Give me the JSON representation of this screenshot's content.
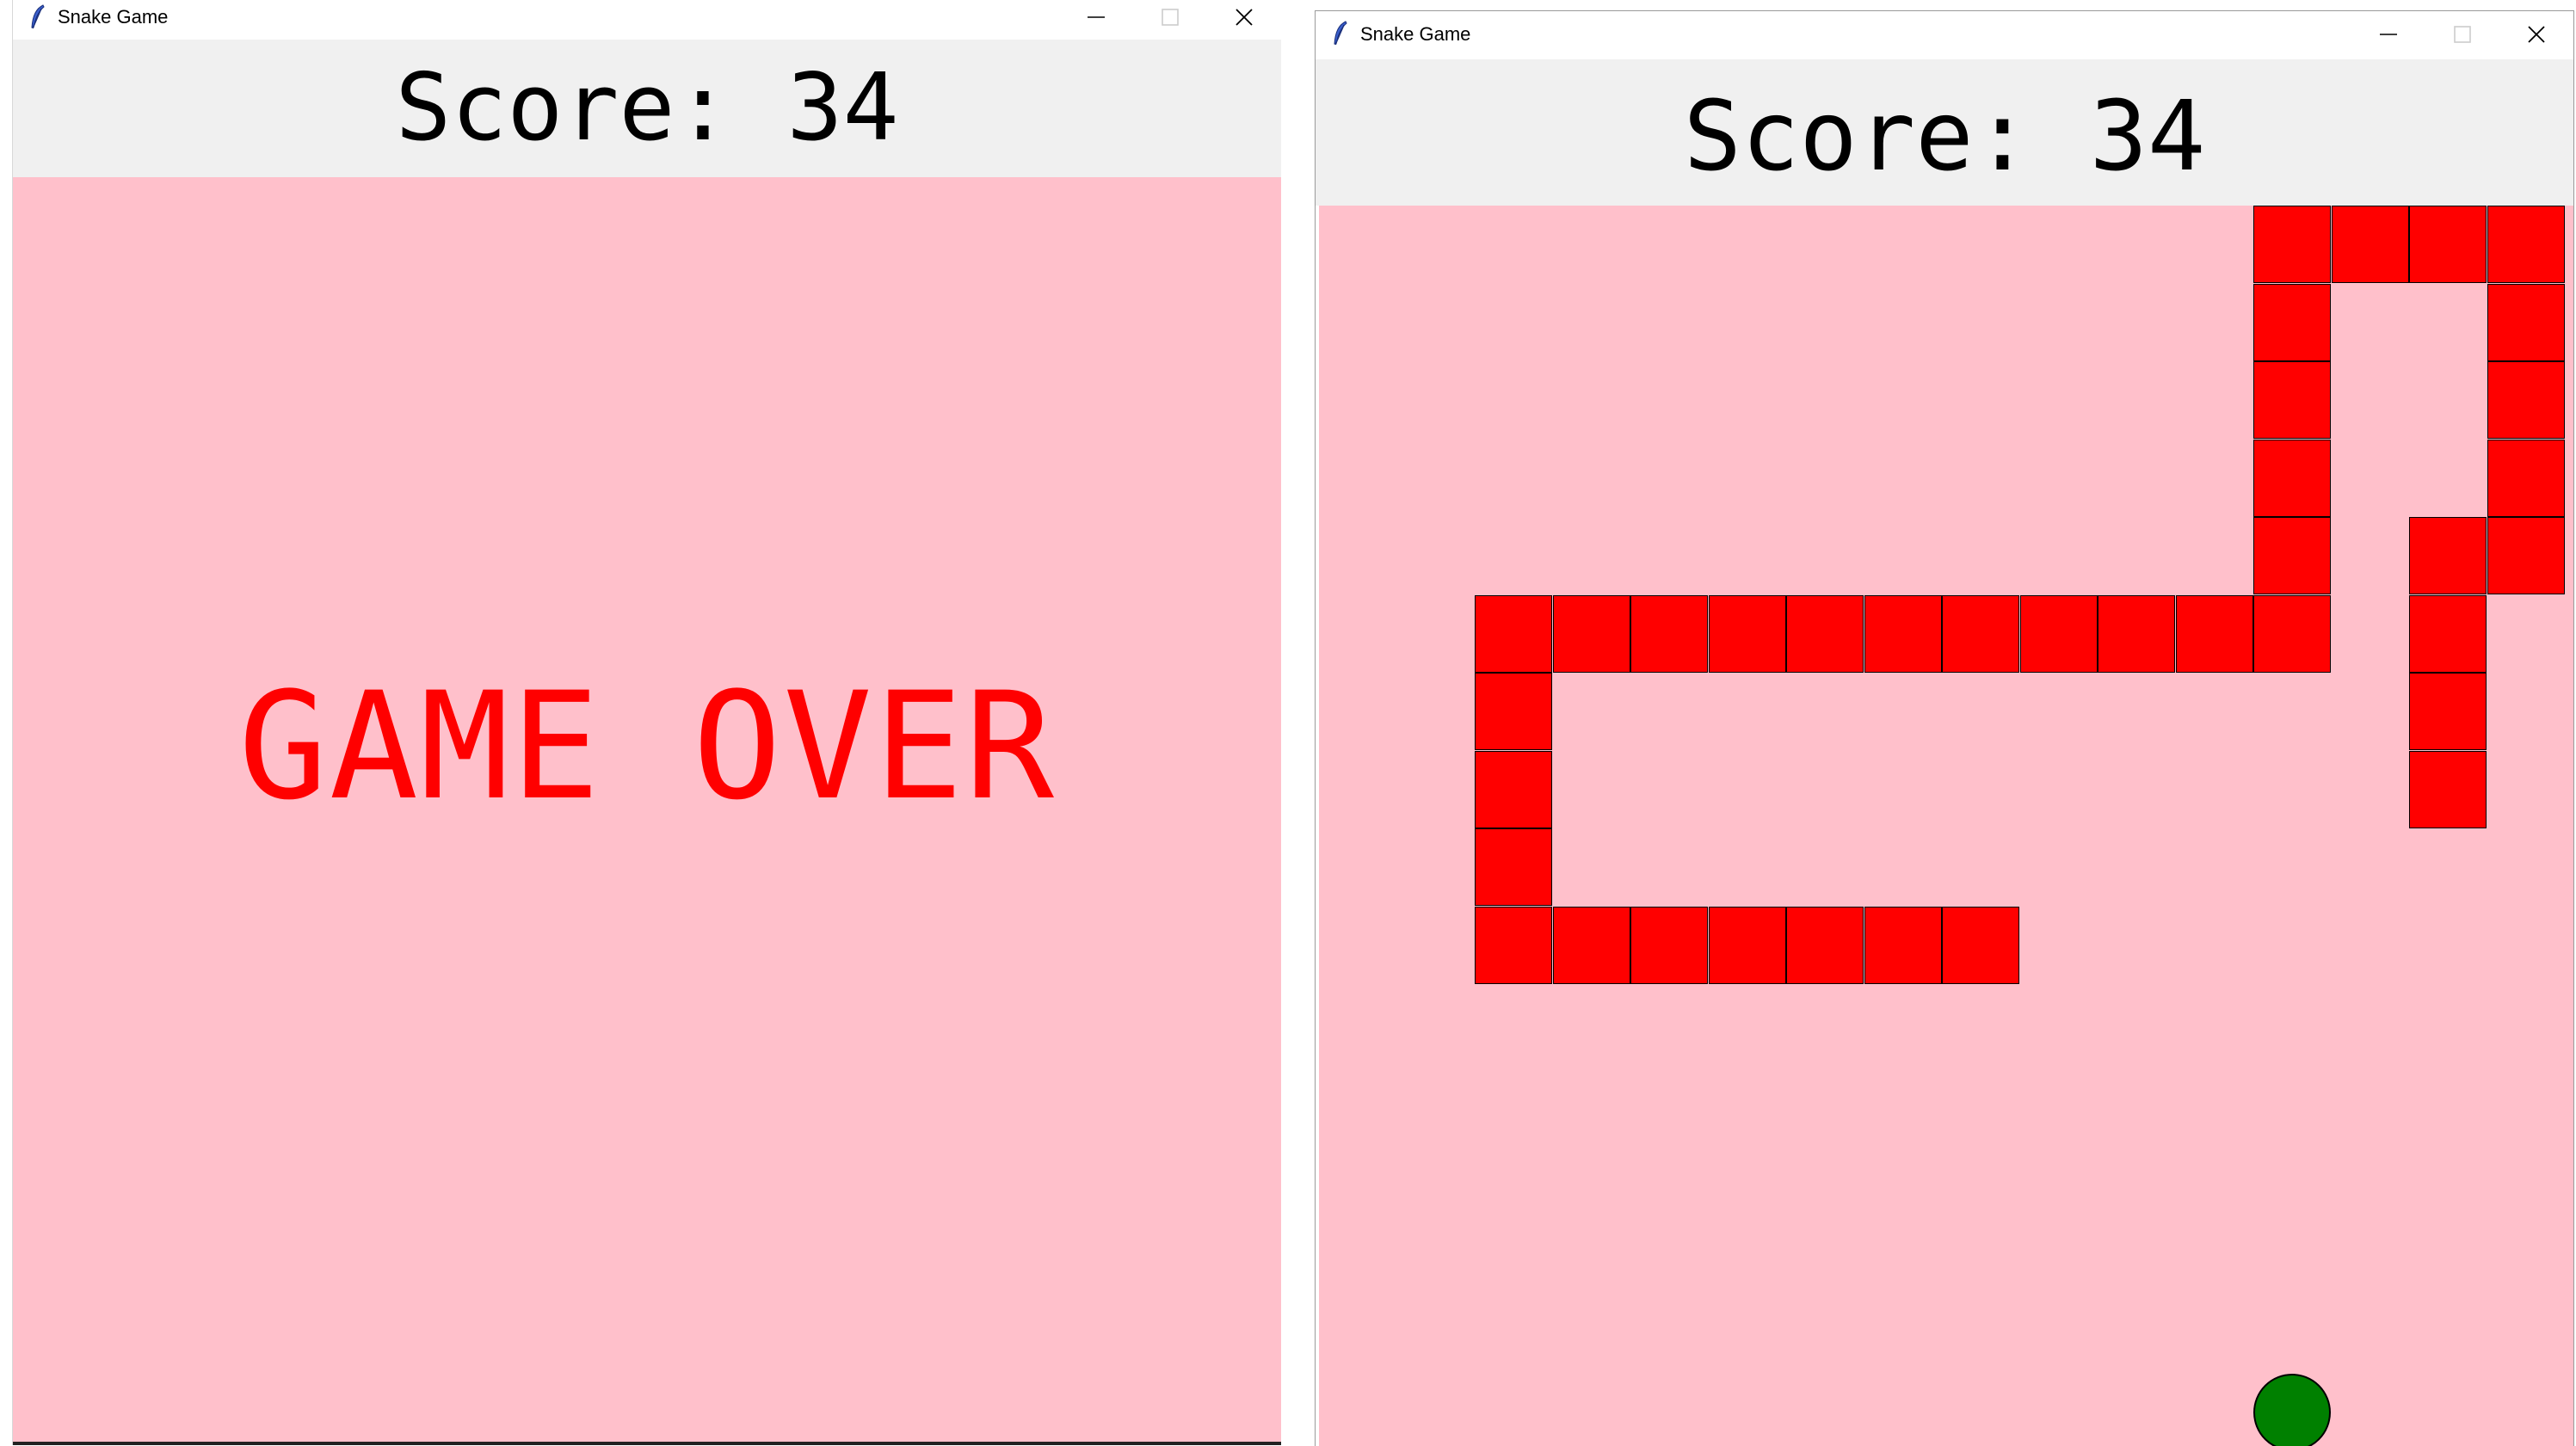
{
  "windows": [
    {
      "title": "Snake Game",
      "score_text": "Score: 34",
      "game_over_text": "GAME OVER"
    },
    {
      "title": "Snake Game",
      "score_text": "Score: 34",
      "grid_size_cells": 16,
      "snake_color": "#ff0000",
      "food_color": "#008000",
      "board_color": "#ffc0cb",
      "snake_cells": [
        [
          12,
          0
        ],
        [
          13,
          0
        ],
        [
          14,
          0
        ],
        [
          15,
          0
        ],
        [
          12,
          1
        ],
        [
          15,
          1
        ],
        [
          12,
          2
        ],
        [
          15,
          2
        ],
        [
          12,
          3
        ],
        [
          15,
          3
        ],
        [
          12,
          4
        ],
        [
          14,
          4
        ],
        [
          15,
          4
        ],
        [
          2,
          5
        ],
        [
          3,
          5
        ],
        [
          4,
          5
        ],
        [
          5,
          5
        ],
        [
          6,
          5
        ],
        [
          7,
          5
        ],
        [
          8,
          5
        ],
        [
          9,
          5
        ],
        [
          10,
          5
        ],
        [
          11,
          5
        ],
        [
          12,
          5
        ],
        [
          14,
          5
        ],
        [
          2,
          6
        ],
        [
          14,
          6
        ],
        [
          2,
          7
        ],
        [
          14,
          7
        ],
        [
          2,
          8
        ],
        [
          2,
          9
        ],
        [
          3,
          9
        ],
        [
          4,
          9
        ],
        [
          5,
          9
        ],
        [
          6,
          9
        ],
        [
          7,
          9
        ],
        [
          8,
          9
        ]
      ],
      "food_cell": [
        12,
        15
      ]
    }
  ],
  "colors": {
    "score_bar_bg": "#f0f0f0",
    "game_over_text": "#ff0000"
  },
  "icons": [
    "feather-icon",
    "minimize-icon",
    "maximize-icon",
    "close-icon"
  ]
}
